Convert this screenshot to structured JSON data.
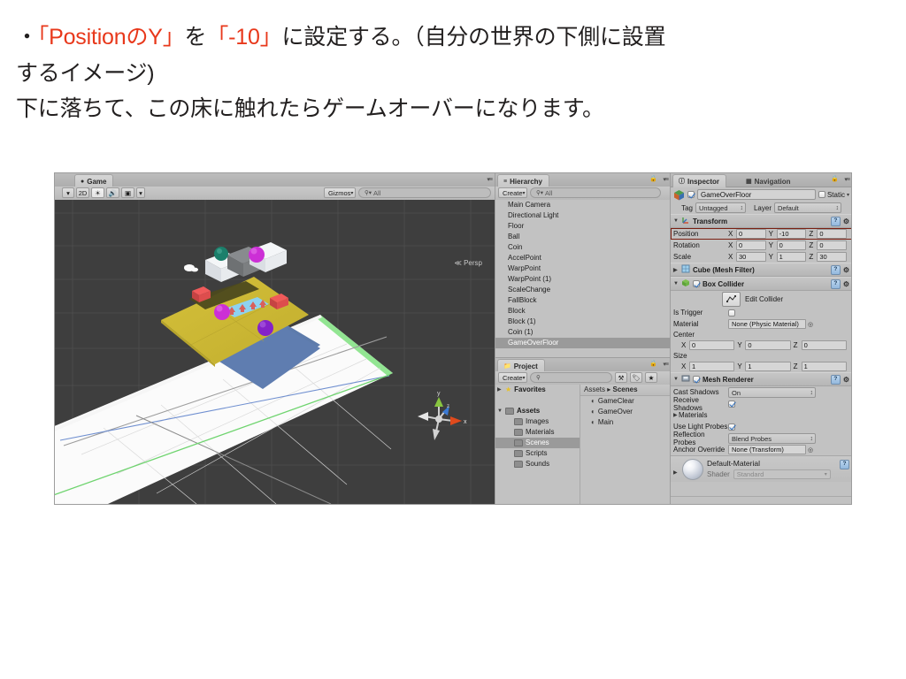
{
  "slide": {
    "line1_bullet": "・",
    "line1_a": "「PositionのY」",
    "line1_b": "を",
    "line1_c": "「-10」",
    "line1_d": "に設定する。（自分の世界の下側に設置",
    "line2": "するイメージ)",
    "line3": "下に落ちて、この床に触れたらゲームオーバーになります。",
    "accent_color": "#e8381b"
  },
  "sceneview": {
    "tab_label": "Game",
    "tab_icon": "game-controller-icon",
    "toolbar": {
      "camera_dropdown": "▾",
      "mode_2d": "2D",
      "light_icon": "☀",
      "audio_icon": "🔊",
      "image_icon": "▣",
      "effects_dropdown": "▾",
      "gizmos_label": "Gizmos",
      "search_placeholder": "All",
      "search_value": ""
    },
    "gizmo": {
      "axis_y": "y",
      "axis_x": "x",
      "axis_z": "z",
      "projection_label": "Persp"
    }
  },
  "hierarchy": {
    "tab_label": "Hierarchy",
    "create_label": "Create",
    "search_placeholder": "All",
    "search_value": "",
    "items": [
      {
        "label": "Main Camera",
        "selected": false
      },
      {
        "label": "Directional Light",
        "selected": false
      },
      {
        "label": "Floor",
        "selected": false
      },
      {
        "label": "Ball",
        "selected": false
      },
      {
        "label": "Coin",
        "selected": false
      },
      {
        "label": "AccelPoint",
        "selected": false
      },
      {
        "label": "WarpPoint",
        "selected": false
      },
      {
        "label": "WarpPoint (1)",
        "selected": false
      },
      {
        "label": "ScaleChange",
        "selected": false
      },
      {
        "label": "FallBlock",
        "selected": false
      },
      {
        "label": "Block",
        "selected": false
      },
      {
        "label": "Block (1)",
        "selected": false
      },
      {
        "label": "Coin (1)",
        "selected": false
      },
      {
        "label": "GameOverFloor",
        "selected": true
      }
    ]
  },
  "project": {
    "tab_label": "Project",
    "create_label": "Create",
    "search_value": "",
    "tree": [
      {
        "label": "Favorites",
        "type": "favorites",
        "depth": 0,
        "expandable": true,
        "selected": false
      },
      {
        "label": "",
        "type": "blank",
        "depth": 0,
        "expandable": false,
        "selected": false
      },
      {
        "label": "Assets",
        "type": "folder",
        "depth": 0,
        "expandable": true,
        "selected": false
      },
      {
        "label": "Images",
        "type": "folder",
        "depth": 1,
        "expandable": false,
        "selected": false
      },
      {
        "label": "Materials",
        "type": "folder",
        "depth": 1,
        "expandable": false,
        "selected": false
      },
      {
        "label": "Scenes",
        "type": "folder",
        "depth": 1,
        "expandable": false,
        "selected": true
      },
      {
        "label": "Scripts",
        "type": "folder",
        "depth": 1,
        "expandable": false,
        "selected": false
      },
      {
        "label": "Sounds",
        "type": "folder",
        "depth": 1,
        "expandable": false,
        "selected": false
      }
    ],
    "breadcrumb_root": "Assets",
    "breadcrumb_sep": "▸",
    "breadcrumb_current": "Scenes",
    "assets": [
      {
        "label": "GameClear",
        "icon": "unity-scene-icon"
      },
      {
        "label": "GameOver",
        "icon": "unity-scene-icon"
      },
      {
        "label": "Main",
        "icon": "unity-scene-icon"
      }
    ]
  },
  "inspector": {
    "tab_label": "Inspector",
    "tab_icon": "info-icon",
    "tab2_label": "Navigation",
    "tab2_icon": "navmesh-icon",
    "object": {
      "enabled": true,
      "name": "GameOverFloor",
      "static_label": "Static",
      "static_checked": false,
      "tag_label": "Tag",
      "tag_value": "Untagged",
      "layer_label": "Layer",
      "layer_value": "Default"
    },
    "transform": {
      "title": "Transform",
      "rows": [
        {
          "label": "Position",
          "x": "0",
          "y": "-10",
          "z": "0",
          "highlighted": true
        },
        {
          "label": "Rotation",
          "x": "0",
          "y": "0",
          "z": "0",
          "highlighted": false
        },
        {
          "label": "Scale",
          "x": "30",
          "y": "1",
          "z": "30",
          "highlighted": false
        }
      ],
      "axis_labels": [
        "X",
        "Y",
        "Z"
      ],
      "highlight_color": "#7a1f12"
    },
    "mesh_filter": {
      "title": "Cube (Mesh Filter)",
      "collapsed": true
    },
    "box_collider": {
      "title": "Box Collider",
      "enabled": true,
      "edit_collider_label": "Edit Collider",
      "is_trigger_label": "Is Trigger",
      "is_trigger_checked": false,
      "material_label": "Material",
      "material_value": "None (Physic Material)",
      "center_label": "Center",
      "center": {
        "x": "0",
        "y": "0",
        "z": "0"
      },
      "size_label": "Size",
      "size": {
        "x": "1",
        "y": "1",
        "z": "1"
      }
    },
    "mesh_renderer": {
      "title": "Mesh Renderer",
      "enabled": true,
      "cast_shadows_label": "Cast Shadows",
      "cast_shadows_value": "On",
      "receive_shadows_label": "Receive Shadows",
      "receive_shadows_checked": true,
      "materials_label": "Materials",
      "use_light_probes_label": "Use Light Probes",
      "use_light_probes_checked": true,
      "reflection_probes_label": "Reflection Probes",
      "reflection_probes_value": "Blend Probes",
      "anchor_override_label": "Anchor Override",
      "anchor_override_value": "None (Transform)"
    },
    "material_preview": {
      "name": "Default-Material",
      "shader_label": "Shader",
      "shader_value": "Standard"
    }
  }
}
